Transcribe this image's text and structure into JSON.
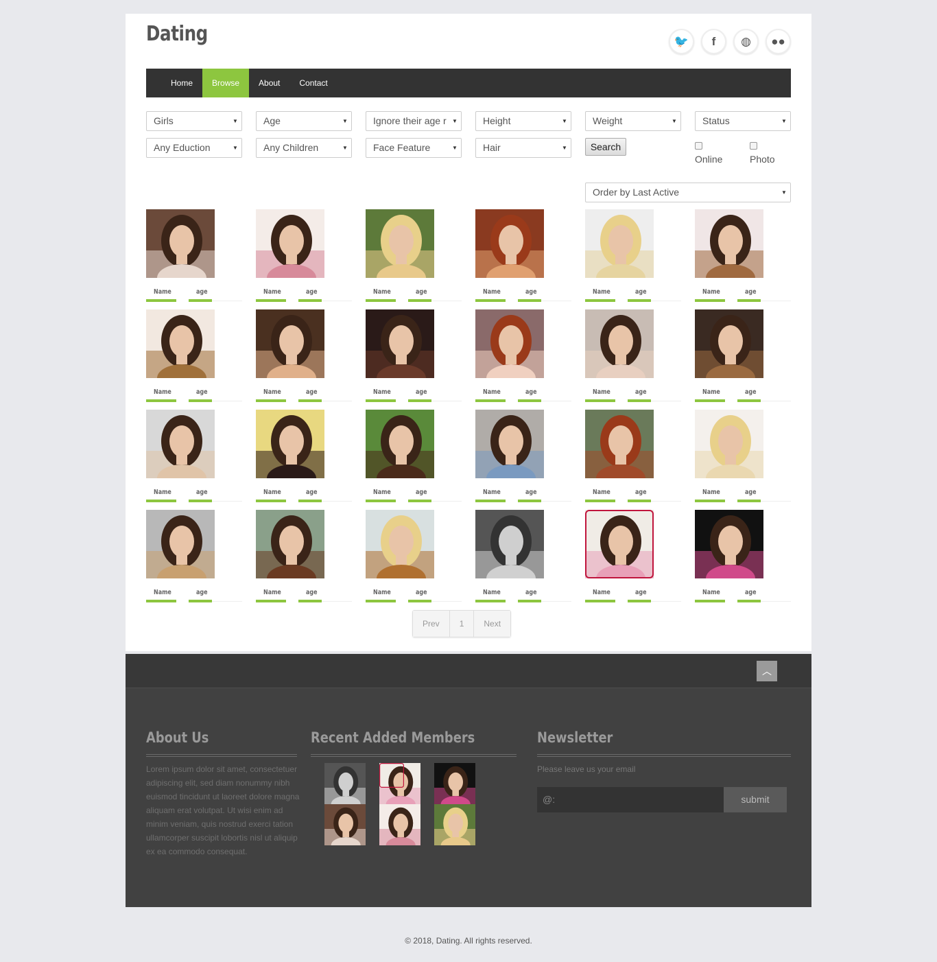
{
  "site": {
    "logo": "Dating"
  },
  "social": [
    {
      "icon": "twitter-icon",
      "glyph": "🐦"
    },
    {
      "icon": "facebook-icon",
      "glyph": "f"
    },
    {
      "icon": "dribbble-icon",
      "glyph": "◍"
    },
    {
      "icon": "flickr-icon",
      "glyph": "●●"
    }
  ],
  "nav": [
    {
      "label": "Home",
      "active": false
    },
    {
      "label": "Browse",
      "active": true
    },
    {
      "label": "About",
      "active": false
    },
    {
      "label": "Contact",
      "active": false
    }
  ],
  "filters": {
    "gender": "Girls",
    "age": "Age",
    "ignore_age": "Ignore their age r",
    "height": "Height",
    "weight": "Weight",
    "status": "Status",
    "education": "Any Eduction",
    "children": "Any Children",
    "face": "Face Feature",
    "hair": "Hair",
    "search": "Search",
    "online": "Online",
    "photo": "Photo",
    "order": "Order by Last Active"
  },
  "members": [
    {
      "name": "Name",
      "age": "age",
      "c1": "#6b4a3a",
      "c2": "#e6d6cc",
      "style": "dark"
    },
    {
      "name": "Name",
      "age": "age",
      "c1": "#f4ece8",
      "c2": "#d78a9a",
      "style": "light"
    },
    {
      "name": "Name",
      "age": "age",
      "c1": "#5d7a3a",
      "c2": "#e8c98a",
      "style": "blonde"
    },
    {
      "name": "Name",
      "age": "age",
      "c1": "#8a3a20",
      "c2": "#e0a070",
      "style": "red"
    },
    {
      "name": "Name",
      "age": "age",
      "c1": "#eeeeee",
      "c2": "#e6d4a0",
      "style": "blonde"
    },
    {
      "name": "Name",
      "age": "age",
      "c1": "#f0e6e6",
      "c2": "#a06a40",
      "style": "light"
    },
    {
      "name": "Name",
      "age": "age",
      "c1": "#f2e8e0",
      "c2": "#a0703a",
      "style": "light"
    },
    {
      "name": "Name",
      "age": "age",
      "c1": "#4a3020",
      "c2": "#e0b08a",
      "style": "dark"
    },
    {
      "name": "Name",
      "age": "age",
      "c1": "#2a1a18",
      "c2": "#6a3a2a",
      "style": "dark"
    },
    {
      "name": "Name",
      "age": "age",
      "c1": "#8a6a6a",
      "c2": "#f0d0c0",
      "style": "red"
    },
    {
      "name": "Name",
      "age": "age",
      "c1": "#c8bcb4",
      "c2": "#e8cfc0",
      "style": "light"
    },
    {
      "name": "Name",
      "age": "age",
      "c1": "#3a2a22",
      "c2": "#9a6a40",
      "style": "dark"
    },
    {
      "name": "Name",
      "age": "age",
      "c1": "#d8d8d8",
      "c2": "#e0c4a8",
      "style": "light"
    },
    {
      "name": "Name",
      "age": "age",
      "c1": "#e8d880",
      "c2": "#2a1a18",
      "style": "dark"
    },
    {
      "name": "Name",
      "age": "age",
      "c1": "#5a8a3a",
      "c2": "#4a2a1a",
      "style": "dark"
    },
    {
      "name": "Name",
      "age": "age",
      "c1": "#b0aca8",
      "c2": "#7a9ac0",
      "style": "light"
    },
    {
      "name": "Name",
      "age": "age",
      "c1": "#6a7a5a",
      "c2": "#a04a2a",
      "style": "red"
    },
    {
      "name": "Name",
      "age": "age",
      "c1": "#f4f0ec",
      "c2": "#ead8b0",
      "style": "blonde"
    },
    {
      "name": "Name",
      "age": "age",
      "c1": "#b8b8b8",
      "c2": "#c8a070",
      "style": "light"
    },
    {
      "name": "Name",
      "age": "age",
      "c1": "#8aa08a",
      "c2": "#6a3a22",
      "style": "dark"
    },
    {
      "name": "Name",
      "age": "age",
      "c1": "#d8e0e0",
      "c2": "#b07030",
      "style": "blonde"
    },
    {
      "name": "Name",
      "age": "age",
      "c1": "#555555",
      "c2": "#d0d0d0",
      "style": "gray"
    },
    {
      "name": "Name",
      "age": "age",
      "c1": "#f0ece6",
      "c2": "#e8a0b8",
      "style": "framed"
    },
    {
      "name": "Name",
      "age": "age",
      "c1": "#111111",
      "c2": "#d04a8a",
      "style": "dark"
    }
  ],
  "pagination": {
    "prev": "Prev",
    "page": "1",
    "next": "Next"
  },
  "footer": {
    "to_top": "︿",
    "about_title": "About Us",
    "about_text": "Lorem ipsum dolor sit amet, consectetuer adipiscing elit, sed diam nonummy nibh euismod tincidunt ut laoreet dolore magna aliquam erat volutpat. Ut wisi enim ad minim veniam, quis nostrud exerci tation ullamcorper suscipit lobortis nisl ut aliquip ex ea commodo consequat.",
    "recent_title": "Recent Added Members",
    "newsletter_title": "Newsletter",
    "newsletter_label": "Please leave us your email",
    "newsletter_placeholder": "@:",
    "submit": "submit"
  },
  "recent": [
    {
      "c1": "#555555",
      "c2": "#d0d0d0",
      "style": "gray"
    },
    {
      "c1": "#f0ece6",
      "c2": "#e8a0b8",
      "style": "framed"
    },
    {
      "c1": "#111111",
      "c2": "#d04a8a",
      "style": "dark"
    },
    {
      "c1": "#6b4a3a",
      "c2": "#e6d6cc",
      "style": "dark"
    },
    {
      "c1": "#f4ece8",
      "c2": "#d78a9a",
      "style": "light"
    },
    {
      "c1": "#5d7a3a",
      "c2": "#e8c98a",
      "style": "blonde"
    }
  ],
  "copyright": "© 2018, Dating. All rights reserved.",
  "colors": {
    "accent": "#8dc63f",
    "nav_bg": "#333333",
    "footer_bg": "#414141"
  }
}
